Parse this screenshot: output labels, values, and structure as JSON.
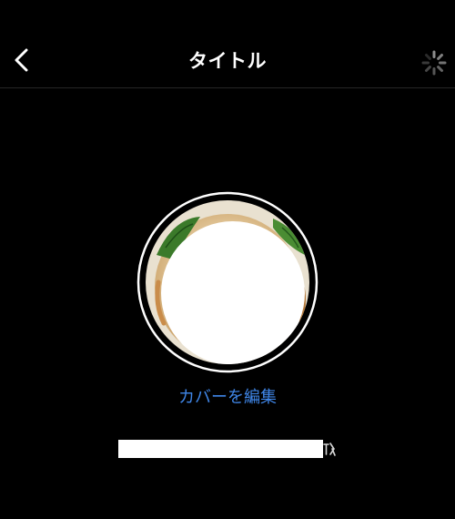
{
  "header": {
    "back_icon": "chevron-left-icon",
    "title": "タイトル",
    "loading_icon": "activity-spinner-icon"
  },
  "cover": {
    "image_description_icon": "food-cover-photo",
    "edit_label": "カバーを編集"
  },
  "name_field": {
    "value": ""
  },
  "colors": {
    "background": "#000000",
    "text": "#ffffff",
    "accent_link": "#3f86e8",
    "divider": "#262626"
  }
}
